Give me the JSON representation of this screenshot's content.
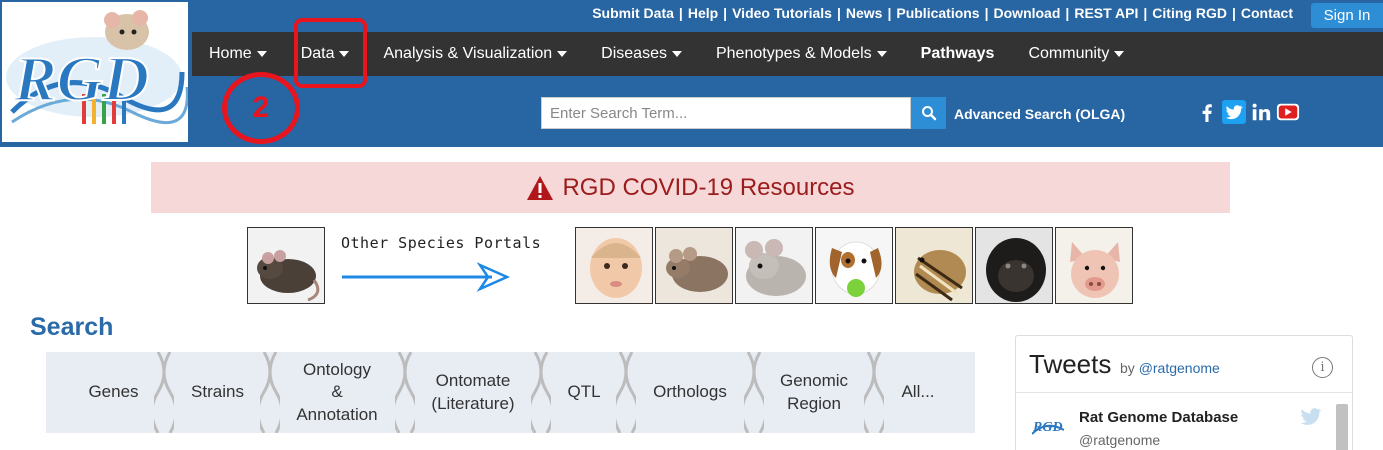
{
  "header": {
    "logo_text": "RGD",
    "top_links": [
      "Submit Data",
      "Help",
      "Video Tutorials",
      "News",
      "Publications",
      "Download",
      "REST API",
      "Citing RGD",
      "Contact"
    ],
    "sign_in": "Sign In",
    "nav": [
      "Home",
      "Data",
      "Analysis & Visualization",
      "Diseases",
      "Phenotypes & Models",
      "Pathways",
      "Community"
    ],
    "search_placeholder": "Enter Search Term...",
    "advanced_search": "Advanced Search (OLGA)",
    "social_icons": [
      "facebook-icon",
      "twitter-icon",
      "linkedin-icon",
      "youtube-icon"
    ]
  },
  "annotation": {
    "step_number": "2",
    "color": "#e8141e"
  },
  "covid": {
    "text": "RGD COVID-19 Resources"
  },
  "portals": {
    "label": "Other Species Portals",
    "species": [
      "rat",
      "human",
      "mouse",
      "chinchilla",
      "dog",
      "squirrel",
      "bonobo",
      "pig"
    ]
  },
  "search": {
    "title": "Search",
    "items": [
      "Genes",
      "Strains",
      "Ontology\n&\nAnnotation",
      "Ontomate\n(Literature)",
      "QTL",
      "Orthologs",
      "Genomic\nRegion",
      "All..."
    ]
  },
  "tweets": {
    "title": "Tweets",
    "by": "by",
    "handle_link": "@ratgenome",
    "account_name": "Rat Genome Database",
    "account_handle": "@ratgenome"
  },
  "colors": {
    "header_blue": "#2765a3",
    "navbar": "#333333",
    "accent_blue": "#2d8ed6",
    "covid_bg": "#f6d8d8",
    "covid_text": "#9b1c1c",
    "search_title": "#2a6aa8"
  }
}
